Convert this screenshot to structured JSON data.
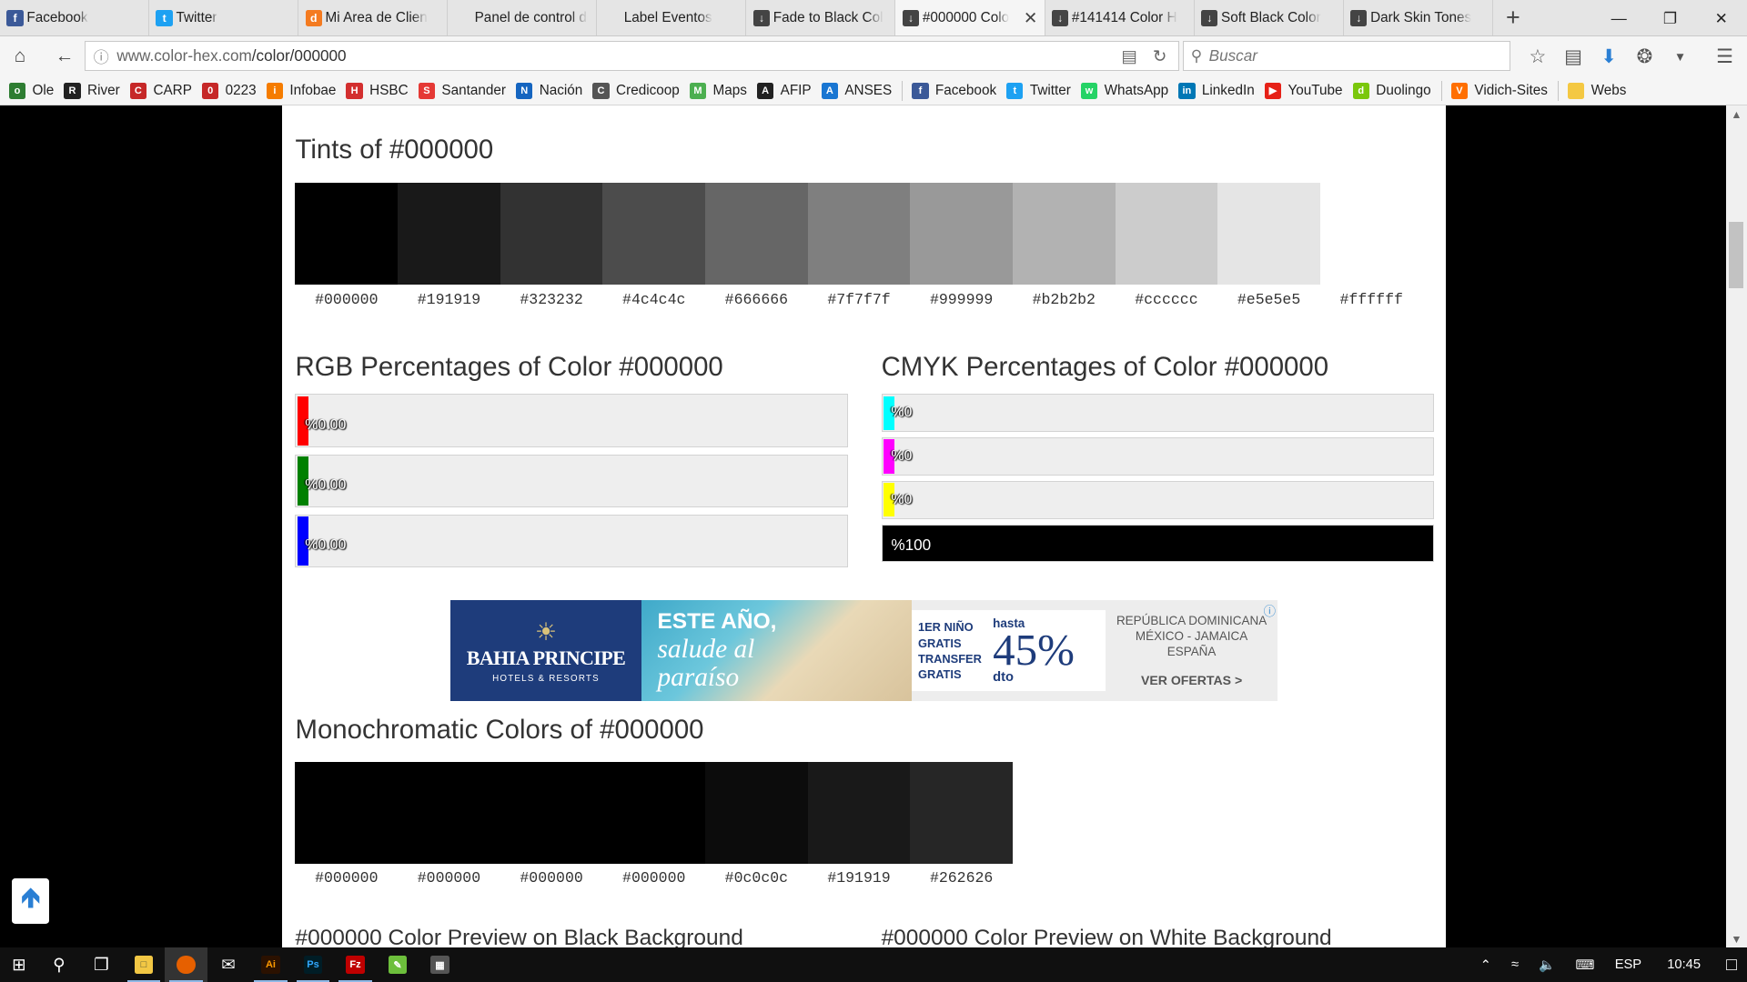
{
  "browser": {
    "tabs": [
      {
        "label": "Facebook",
        "icon": "facebook-icon",
        "color": "#3b5998",
        "glyph": "f"
      },
      {
        "label": "Twitter",
        "icon": "twitter-icon",
        "color": "#1da1f2",
        "glyph": "t"
      },
      {
        "label": "Mi Area de Clien",
        "icon": "d-icon",
        "color": "#f47b20",
        "glyph": "d"
      },
      {
        "label": "Panel de control de h",
        "icon": "",
        "color": "",
        "glyph": ""
      },
      {
        "label": "Label Eventos",
        "icon": "",
        "color": "",
        "glyph": ""
      },
      {
        "label": "Fade to Black Col",
        "icon": "dropper-icon",
        "color": "#444",
        "glyph": "↓"
      },
      {
        "label": "#000000 Colo",
        "icon": "dropper-icon",
        "color": "#444",
        "glyph": "↓",
        "active": true
      },
      {
        "label": "#141414 Color H",
        "icon": "dropper-icon",
        "color": "#444",
        "glyph": "↓"
      },
      {
        "label": "Soft Black Color",
        "icon": "dropper-icon",
        "color": "#444",
        "glyph": "↓"
      },
      {
        "label": "Dark Skin Tones",
        "icon": "dropper-icon",
        "color": "#444",
        "glyph": "↓"
      }
    ],
    "url_host": "www.color-hex.com",
    "url_path": "/color/000000",
    "search_placeholder": "Buscar",
    "bookmarks": [
      {
        "label": "Ole",
        "color": "#2e7d32",
        "glyph": "o"
      },
      {
        "label": "River",
        "color": "#222",
        "glyph": "R"
      },
      {
        "label": "CARP",
        "color": "#c62828",
        "glyph": "C"
      },
      {
        "label": "0223",
        "color": "#c62828",
        "glyph": "0"
      },
      {
        "label": "Infobae",
        "color": "#f57c00",
        "glyph": "i"
      },
      {
        "label": "HSBC",
        "color": "#d32f2f",
        "glyph": "H"
      },
      {
        "label": "Santander",
        "color": "#e53935",
        "glyph": "S"
      },
      {
        "label": "Nación",
        "color": "#1565c0",
        "glyph": "N"
      },
      {
        "label": "Credicoop",
        "color": "#555",
        "glyph": "C"
      },
      {
        "label": "Maps",
        "color": "#4caf50",
        "glyph": "M"
      },
      {
        "label": "AFIP",
        "color": "#222",
        "glyph": "A"
      },
      {
        "label": "ANSES",
        "color": "#1976d2",
        "glyph": "A"
      },
      {
        "label": "Facebook",
        "color": "#3b5998",
        "glyph": "f"
      },
      {
        "label": "Twitter",
        "color": "#1da1f2",
        "glyph": "t"
      },
      {
        "label": "WhatsApp",
        "color": "#25d366",
        "glyph": "w"
      },
      {
        "label": "LinkedIn",
        "color": "#0077b5",
        "glyph": "in"
      },
      {
        "label": "YouTube",
        "color": "#e62117",
        "glyph": "▶"
      },
      {
        "label": "Duolingo",
        "color": "#7ac70c",
        "glyph": "d"
      },
      {
        "label": "Vidich-Sites",
        "color": "#ff6f00",
        "glyph": "V"
      },
      {
        "label": "Webs",
        "color": "#f4c842",
        "glyph": ""
      }
    ]
  },
  "page": {
    "tints_title": "Tints of #000000",
    "tints": [
      "#000000",
      "#191919",
      "#323232",
      "#4c4c4c",
      "#666666",
      "#7f7f7f",
      "#999999",
      "#b2b2b2",
      "#cccccc",
      "#e5e5e5",
      "#ffffff"
    ],
    "rgb_title": "RGB Percentages of Color #000000",
    "rgb": [
      {
        "label": "%0.00",
        "color": "#ff0000",
        "value": 0
      },
      {
        "label": "%0.00",
        "color": "#008000",
        "value": 0
      },
      {
        "label": "%0.00",
        "color": "#0000ff",
        "value": 0
      }
    ],
    "cmyk_title": "CMYK Percentages of Color #000000",
    "cmyk": [
      {
        "label": "%0",
        "color": "#00ffff",
        "value": 0
      },
      {
        "label": "%0",
        "color": "#ff00ff",
        "value": 0
      },
      {
        "label": "%0",
        "color": "#ffff00",
        "value": 0
      },
      {
        "label": "%100",
        "color": "#000000",
        "value": 100
      }
    ],
    "ad": {
      "brand": "BAHIA PRINCIPE",
      "brand_sub": "HOTELS & RESORTS",
      "headline": "ESTE AÑO,",
      "tagline_1": "salude al",
      "tagline_2": "paraíso",
      "offer_1": "1ER NIÑO",
      "offer_1b": "GRATIS",
      "offer_2": "TRANSFER",
      "offer_2b": "GRATIS",
      "up_to": "hasta",
      "discount": "45%",
      "dto": "dto",
      "dest_1": "REPÚBLICA DOMINICANA",
      "dest_2": "MÉXICO - JAMAICA",
      "dest_3": "ESPAÑA",
      "cta": "VER OFERTAS >"
    },
    "mono_title": "Monochromatic Colors of #000000",
    "mono": [
      "#000000",
      "#000000",
      "#000000",
      "#000000",
      "#0c0c0c",
      "#191919",
      "#262626"
    ],
    "preview_black_title": "#000000 Color Preview on Black Background",
    "preview_white_title": "#000000 Color Preview on White Background"
  },
  "taskbar": {
    "lang": "ESP",
    "time": "10:45"
  }
}
